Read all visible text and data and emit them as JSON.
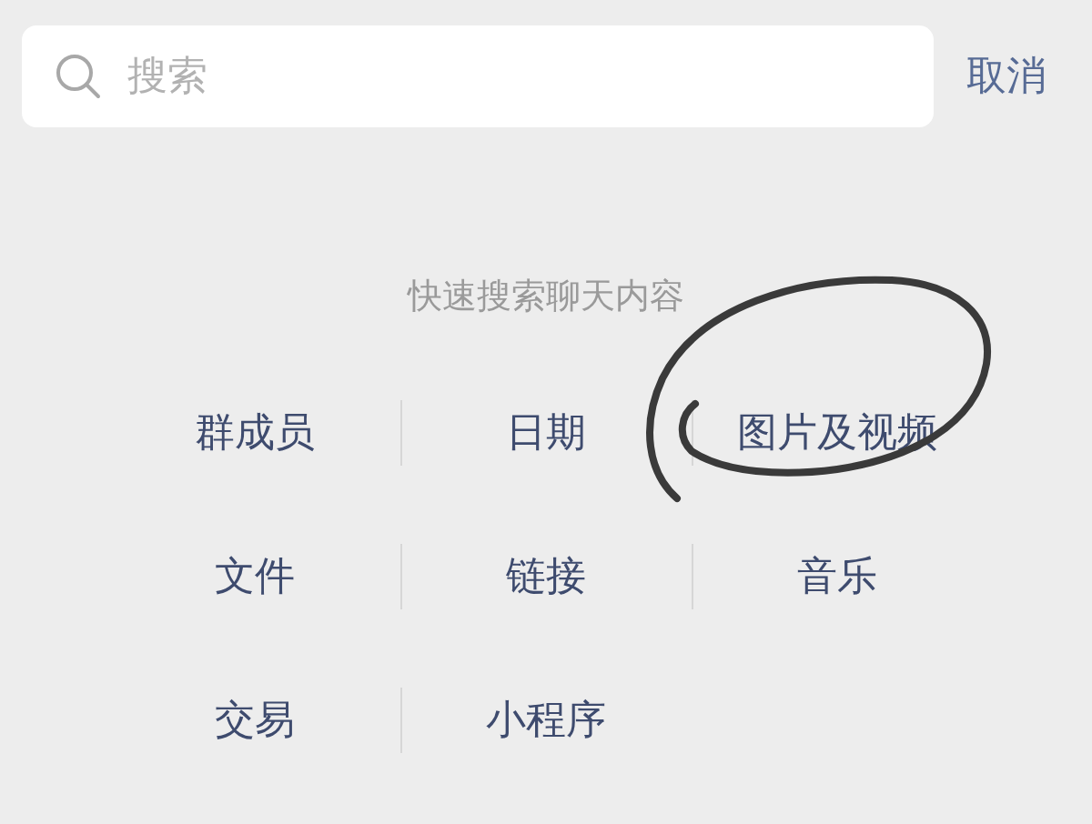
{
  "search": {
    "placeholder": "搜索"
  },
  "cancel": "取消",
  "title": "快速搜索聊天内容",
  "categories": [
    "群成员",
    "日期",
    "图片及视频",
    "文件",
    "链接",
    "音乐",
    "交易",
    "小程序"
  ],
  "annotation": {
    "kind": "circle"
  }
}
